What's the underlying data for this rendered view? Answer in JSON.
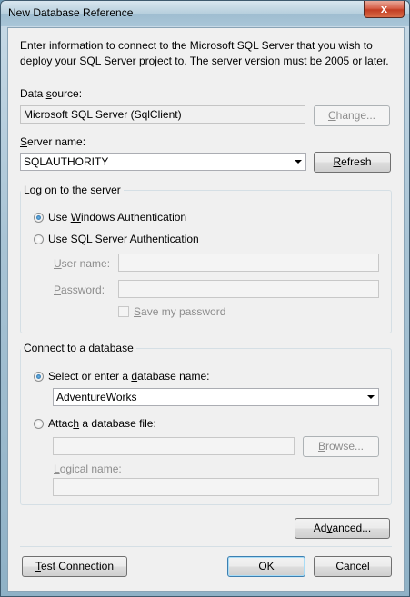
{
  "window": {
    "title": "New Database Reference",
    "close_glyph": "x"
  },
  "intro": {
    "line1": "Enter information to connect to the Microsoft SQL Server that you wish to",
    "line2": "deploy your SQL Server project to.  The server version must be 2005 or later."
  },
  "data_source": {
    "label_pre": "Data ",
    "label_key": "s",
    "label_post": "ource:",
    "value": "Microsoft SQL Server (SqlClient)",
    "change_pre": "",
    "change_key": "C",
    "change_post": "hange..."
  },
  "server": {
    "label_key": "S",
    "label_post": "erver name:",
    "value": "SQLAUTHORITY",
    "refresh_key": "R",
    "refresh_post": "efresh"
  },
  "logon": {
    "title": "Log on to the server",
    "windows_auth": {
      "pre": "Use ",
      "key": "W",
      "post": "indows Authentication",
      "selected": true
    },
    "sql_auth": {
      "pre": "Use S",
      "key": "Q",
      "post": "L Server Authentication",
      "selected": false
    },
    "user_name": {
      "key": "U",
      "post": "ser name:",
      "value": ""
    },
    "password": {
      "key": "P",
      "post": "assword:",
      "value": ""
    },
    "save_password": {
      "pre": "",
      "key": "S",
      "post": "ave my password",
      "checked": false
    }
  },
  "connect_db": {
    "title": "Connect to a database",
    "select_db": {
      "pre": "Select or enter a ",
      "key": "d",
      "post": "atabase name:",
      "selected": true
    },
    "db_name": "AdventureWorks",
    "attach_file": {
      "pre": "Attac",
      "key": "h",
      "post": " a database file:",
      "selected": false
    },
    "file_value": "",
    "browse_key": "B",
    "browse_post": "rowse...",
    "logical_name": {
      "key": "L",
      "post": "ogical name:",
      "value": ""
    }
  },
  "buttons": {
    "advanced_pre": "Ad",
    "advanced_key": "v",
    "advanced_post": "anced...",
    "test_key": "T",
    "test_post": "est Connection",
    "ok": "OK",
    "cancel": "Cancel"
  },
  "colors": {
    "accent": "#3c7fb1",
    "close_red": "#c23d22",
    "disabled_text": "#8d8d8d"
  }
}
